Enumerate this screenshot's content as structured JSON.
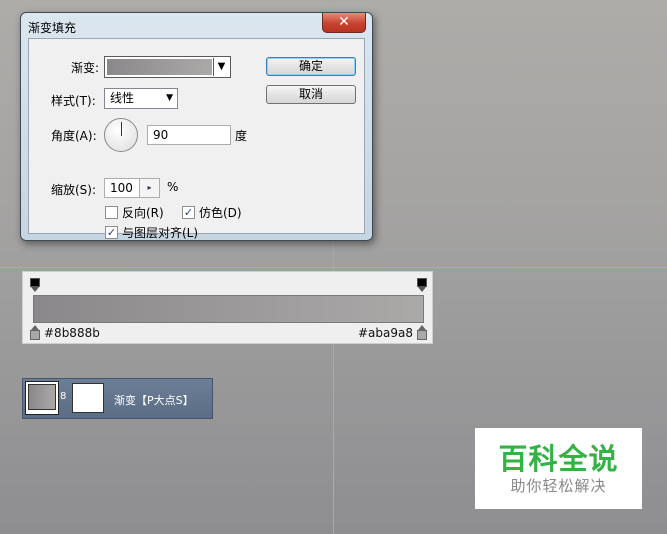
{
  "dialog": {
    "title": "渐变填充",
    "close_glyph": "✕",
    "gradient_label": "渐变:",
    "style_label": "样式(T):",
    "style_value": "线性",
    "angle_label": "角度(A):",
    "angle_value": "90",
    "angle_unit": "度",
    "scale_label": "缩放(S):",
    "scale_value": "100",
    "scale_unit": "%",
    "reverse_label": "反向(R)",
    "reverse_checked": false,
    "dither_label": "仿色(D)",
    "dither_checked": true,
    "align_label": "与图层对齐(L)",
    "align_checked": true,
    "ok_label": "确定",
    "cancel_label": "取消"
  },
  "gradient_bar": {
    "left_color": "#8b888b",
    "right_color": "#aba9a8",
    "left_hex_label": "#8b888b",
    "right_hex_label": "#aba9a8"
  },
  "layer": {
    "link_glyph": "8",
    "name": "渐变【P大点S】"
  },
  "watermark": {
    "title": "百科全说",
    "subtitle": "助你轻松解决"
  },
  "colors": {
    "accent_green": "#35b245",
    "guide_cyan": "#3fd6d6"
  }
}
